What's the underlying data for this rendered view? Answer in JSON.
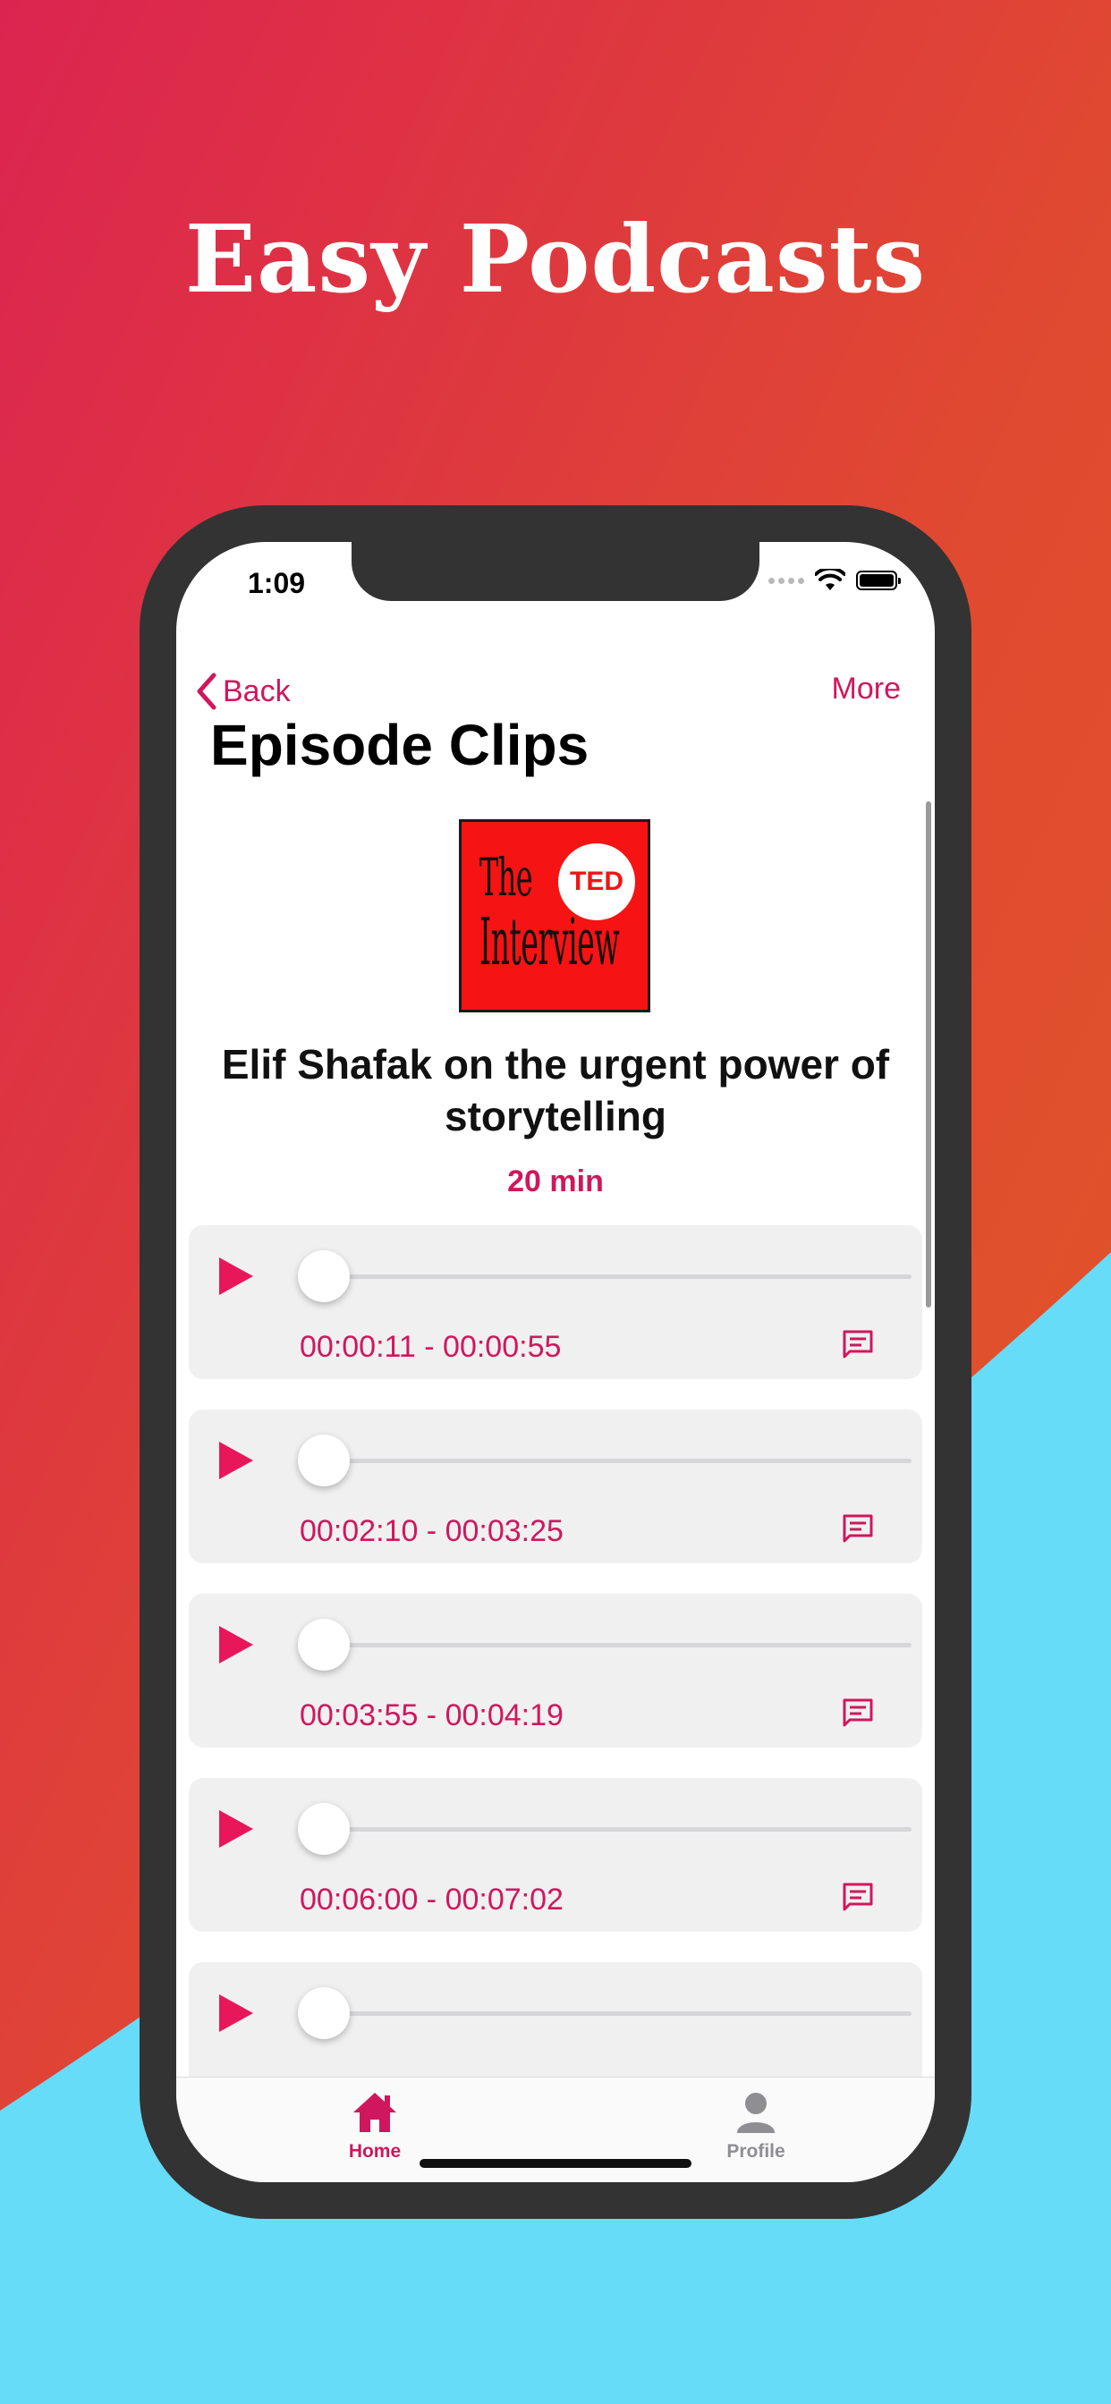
{
  "headline": "Easy Podcasts",
  "colors": {
    "accent": "#d0175d",
    "play": "#e8175a",
    "bg_red": "#e03a3c",
    "bg_orange": "#e05a25",
    "bg_cyan": "#66dcf8",
    "phone_frame": "#333333"
  },
  "status_bar": {
    "time": "1:09"
  },
  "nav": {
    "back_label": "Back",
    "more_label": "More"
  },
  "page_title": "Episode Clips",
  "podcast": {
    "cover_the": "The",
    "cover_ted": "TED",
    "cover_interview": "Interview"
  },
  "episode": {
    "title": "Elif Shafak on the urgent power of storytelling",
    "duration": "20 min"
  },
  "clips": [
    {
      "range": "00:00:11 - 00:00:55",
      "progress": 0
    },
    {
      "range": "00:02:10 - 00:03:25",
      "progress": 0
    },
    {
      "range": "00:03:55 - 00:04:19",
      "progress": 0
    },
    {
      "range": "00:06:00 - 00:07:02",
      "progress": 0
    },
    {
      "range": "",
      "progress": 0
    }
  ],
  "tabbar": {
    "home_label": "Home",
    "profile_label": "Profile"
  },
  "icons": {
    "back": "chevron-left-icon",
    "play": "play-icon",
    "comment": "comment-icon",
    "home": "home-icon",
    "profile": "person-icon",
    "wifi": "wifi-icon",
    "battery": "battery-icon"
  }
}
